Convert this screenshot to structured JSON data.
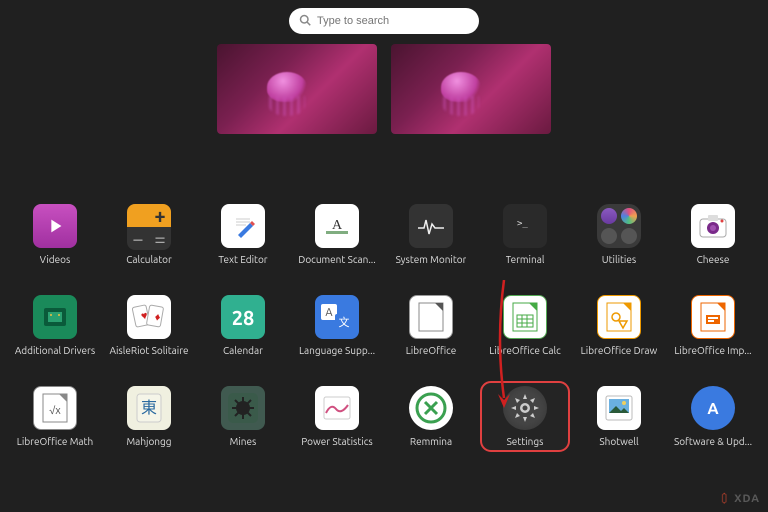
{
  "search": {
    "placeholder": "Type to search"
  },
  "workspaces": {
    "count": 2
  },
  "apps": [
    {
      "label": "Videos",
      "icon": "videos"
    },
    {
      "label": "Calculator",
      "icon": "calc"
    },
    {
      "label": "Text Editor",
      "icon": "text"
    },
    {
      "label": "Document Scan...",
      "icon": "scan"
    },
    {
      "label": "System Monitor",
      "icon": "sysmon"
    },
    {
      "label": "Terminal",
      "icon": "term"
    },
    {
      "label": "Utilities",
      "icon": "util"
    },
    {
      "label": "Cheese",
      "icon": "cheese"
    },
    {
      "label": "Additional Drivers",
      "icon": "drv"
    },
    {
      "label": "AisleRiot Solitaire",
      "icon": "cards"
    },
    {
      "label": "Calendar",
      "icon": "cal",
      "text": "28"
    },
    {
      "label": "Language Supp...",
      "icon": "lang"
    },
    {
      "label": "LibreOffice",
      "icon": "libre"
    },
    {
      "label": "LibreOffice Calc",
      "icon": "calc2"
    },
    {
      "label": "LibreOffice Draw",
      "icon": "draw"
    },
    {
      "label": "LibreOffice Imp...",
      "icon": "imp"
    },
    {
      "label": "LibreOffice Math",
      "icon": "math"
    },
    {
      "label": "Mahjongg",
      "icon": "mah"
    },
    {
      "label": "Mines",
      "icon": "mines"
    },
    {
      "label": "Power Statistics",
      "icon": "power"
    },
    {
      "label": "Remmina",
      "icon": "remmina"
    },
    {
      "label": "Settings",
      "icon": "settings",
      "highlighted": true
    },
    {
      "label": "Shotwell",
      "icon": "shotwell"
    },
    {
      "label": "Software & Upd...",
      "icon": "software"
    }
  ],
  "annotation": {
    "arrow_target": "Settings"
  },
  "watermark": "XDA"
}
